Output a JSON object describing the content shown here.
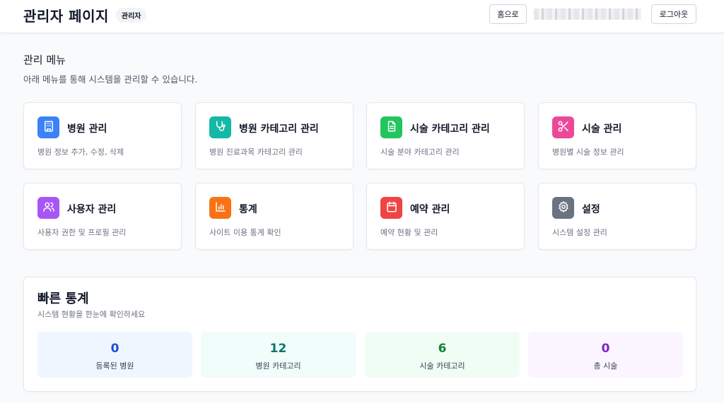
{
  "header": {
    "title": "관리자 페이지",
    "role_badge": "관리자",
    "home_label": "홈으로",
    "user_info": "",
    "logout_label": "로그아웃"
  },
  "menu": {
    "title": "관리 메뉴",
    "description": "아래 메뉴를 통해 시스템을 관리할 수 있습니다.",
    "items": [
      {
        "title": "병원 관리",
        "description": "병원 정보 추가, 수정, 삭제",
        "icon": "hospital-icon",
        "color": "#3b82f6"
      },
      {
        "title": "병원 카테고리 관리",
        "description": "병원 진료과목 카테고리 관리",
        "icon": "stethoscope-icon",
        "color": "#14b8a6"
      },
      {
        "title": "시술 카테고리 관리",
        "description": "시술 분야 카테고리 관리",
        "icon": "document-icon",
        "color": "#22c55e"
      },
      {
        "title": "시술 관리",
        "description": "병원별 시술 정보 관리",
        "icon": "scissors-icon",
        "color": "#ec4899"
      },
      {
        "title": "사용자 관리",
        "description": "사용자 권한 및 프로필 관리",
        "icon": "users-icon",
        "color": "#a855f7"
      },
      {
        "title": "통계",
        "description": "사이트 이용 통계 확인",
        "icon": "bar-chart-icon",
        "color": "#f97316"
      },
      {
        "title": "예약 관리",
        "description": "예약 현황 및 관리",
        "icon": "calendar-icon",
        "color": "#ef4444"
      },
      {
        "title": "설정",
        "description": "시스템 설정 관리",
        "icon": "gear-icon",
        "color": "#6b7280"
      }
    ]
  },
  "stats": {
    "title": "빠른 통계",
    "description": "시스템 현황을 한눈에 확인하세요",
    "items": [
      {
        "value": "0",
        "label": "등록된 병원",
        "color": "#1d4ed8",
        "bg": "#eff6ff"
      },
      {
        "value": "12",
        "label": "병원 카테고리",
        "color": "#0f766e",
        "bg": "#f0fdfa"
      },
      {
        "value": "6",
        "label": "시술 카테고리",
        "color": "#15803d",
        "bg": "#f0fdf4"
      },
      {
        "value": "0",
        "label": "총 시술",
        "color": "#7e22ce",
        "bg": "#faf5ff"
      }
    ]
  }
}
